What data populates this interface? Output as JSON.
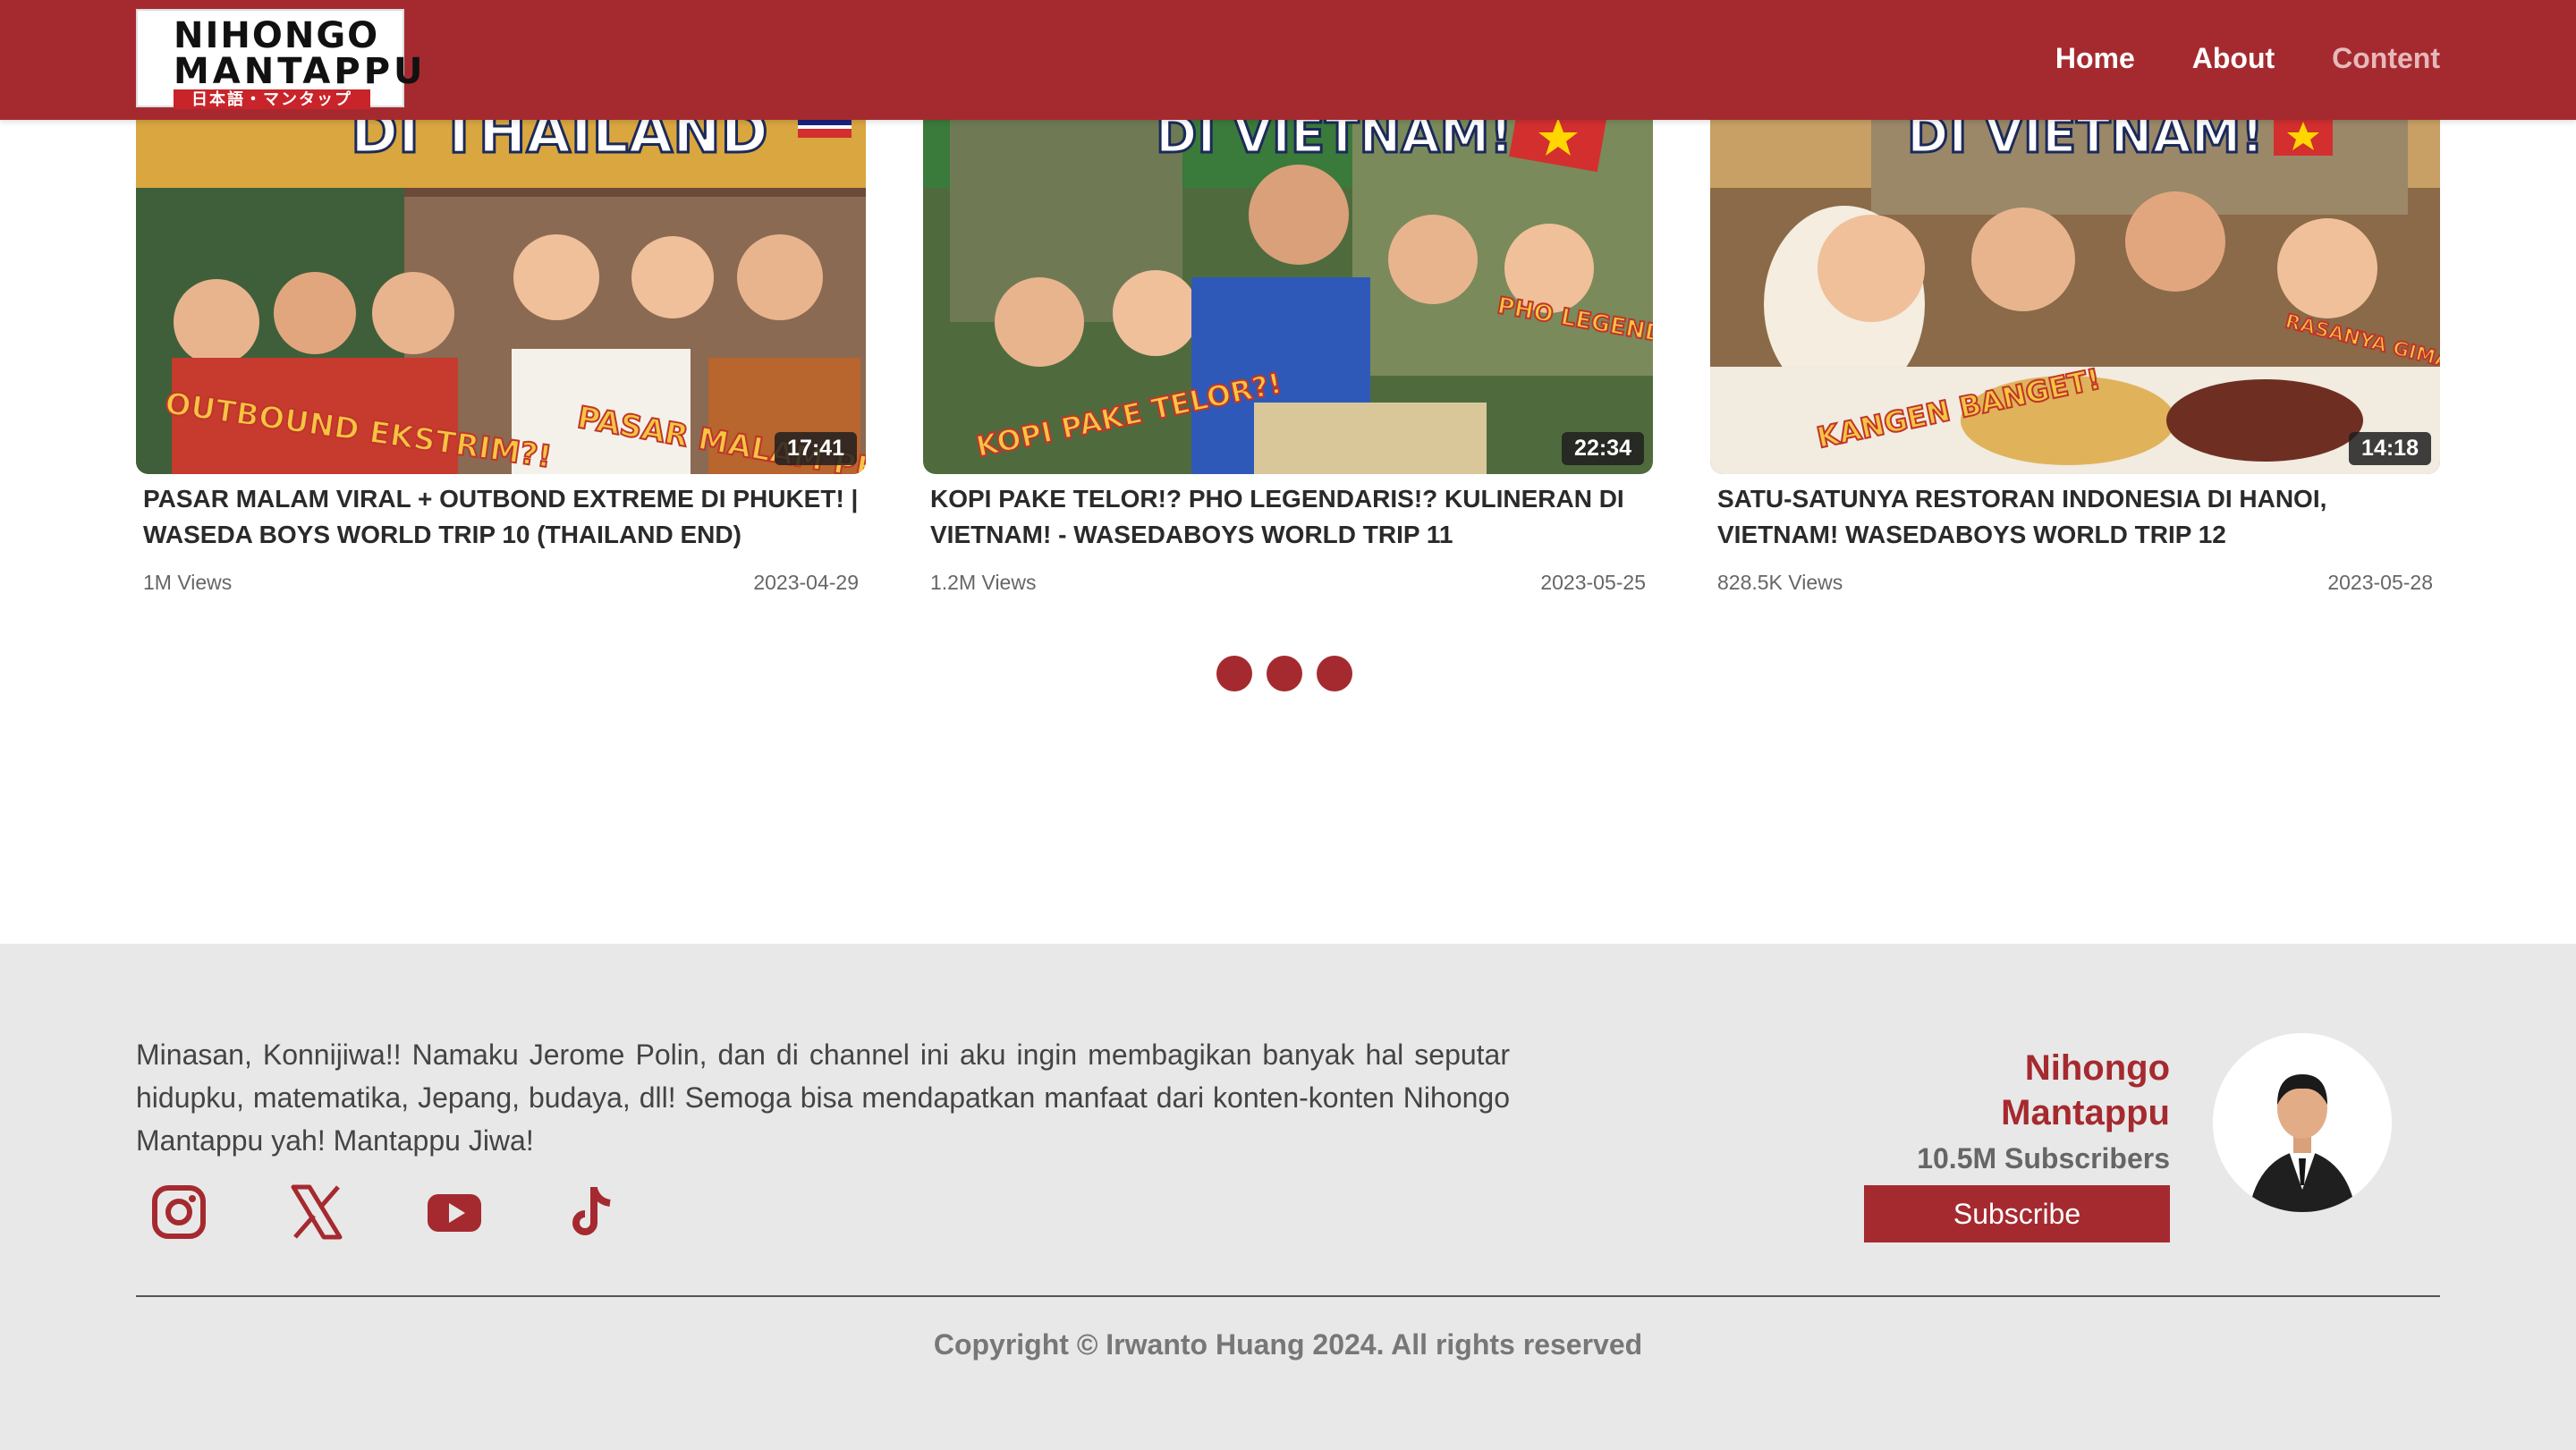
{
  "nav": {
    "logo": {
      "line1": "NIHONGO",
      "line2": "MANTAPPU",
      "line3": "日本語・マンタップ"
    },
    "links": [
      "Home",
      "About",
      "Content"
    ]
  },
  "videos": [
    {
      "thumb_heading": "DI THAILAND",
      "thumb_sticker_left": "OUTBOUND EKSTRIM?!",
      "thumb_sticker_right": "PASAR MALAM PHUKET",
      "duration": "17:41",
      "title": "PASAR MALAM VIRAL + OUTBOND EXTREME DI PHUKET! | WASEDA BOYS WORLD TRIP 10 (THAILAND END)",
      "views": "1M Views",
      "date": "2023-04-29"
    },
    {
      "thumb_heading": "DI VIETNAM!",
      "thumb_sticker_left": "KOPI PAKE TELOR?!",
      "thumb_sticker_right": "PHO LEGENDARIS!!",
      "duration": "22:34",
      "title": "KOPI PAKE TELOR!? PHO LEGENDARIS!? KULINERAN DI VIETNAM! - WASEDABOYS WORLD TRIP 11",
      "views": "1.2M Views",
      "date": "2023-05-25"
    },
    {
      "thumb_heading": "DI VIETNAM!",
      "thumb_sticker_left": "KANGEN BANGET!",
      "thumb_sticker_right": "RASANYA GIMANA YA?!",
      "duration": "14:18",
      "title": "SATU-SATUNYA RESTORAN INDONESIA DI HANOI, VIETNAM! WASEDABOYS WORLD TRIP 12",
      "views": "828.5K Views",
      "date": "2023-05-28"
    }
  ],
  "footer": {
    "about": "Minasan, Konnijiwa!! Namaku Jerome Polin, dan di channel ini aku ingin membagikan banyak hal seputar hidupku, matematika, Jepang, budaya, dll! Semoga bisa mendapatkan manfaat dari konten-konten Nihongo Mantappu yah! Mantappu Jiwa!",
    "socials": [
      "instagram-icon",
      "x-icon",
      "youtube-icon",
      "tiktok-icon"
    ],
    "channel_name": "Nihongo Mantappu",
    "subscribers": "10.5M Subscribers",
    "subscribe_label": "Subscribe",
    "copyright": "Copyright © Irwanto Huang 2024. All rights reserved"
  },
  "colors": {
    "brand": "#a52a2f",
    "footer_bg": "#e8e8e8"
  }
}
